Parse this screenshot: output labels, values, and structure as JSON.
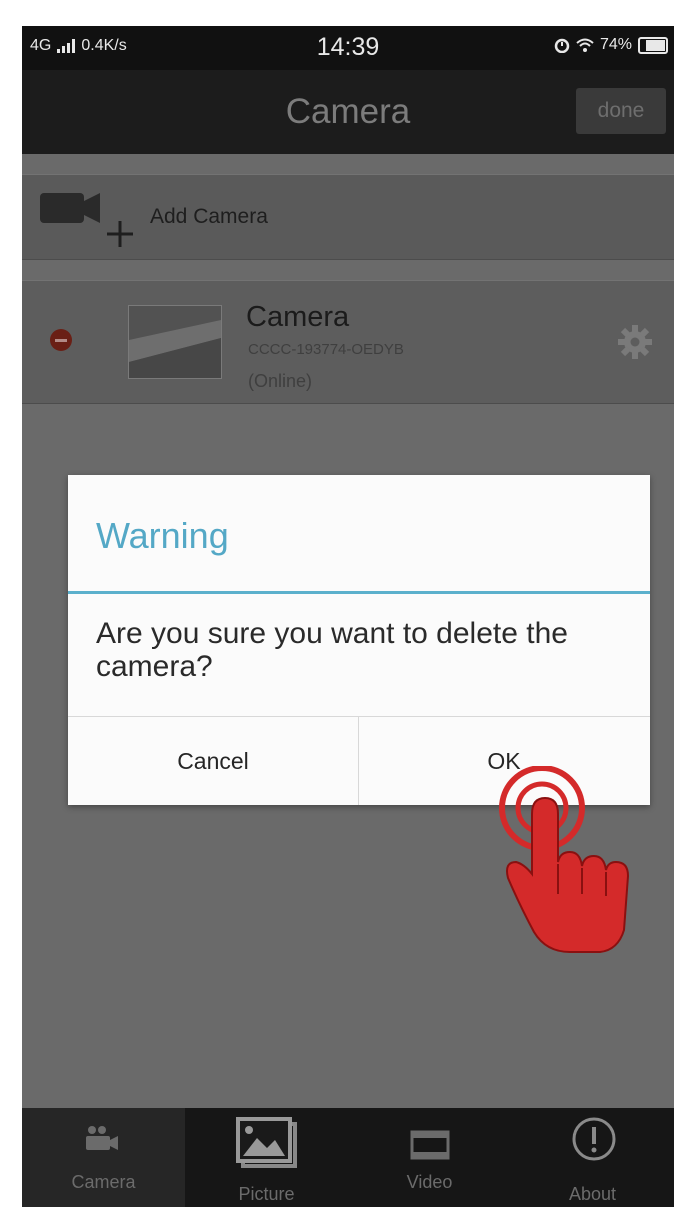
{
  "status_bar": {
    "network": "4G",
    "speed": "0.4K/s",
    "time": "14:39",
    "battery": "74%"
  },
  "header": {
    "title": "Camera",
    "done_label": "done"
  },
  "add_camera": {
    "label": "Add Camera"
  },
  "camera_item": {
    "name": "Camera",
    "id": "CCCC-193774-OEDYB",
    "status": "(Online)"
  },
  "dialog": {
    "title": "Warning",
    "message": "Are you sure you want to delete the camera?",
    "cancel_label": "Cancel",
    "ok_label": "OK"
  },
  "tabs": [
    {
      "label": "Camera",
      "icon": "camera-tab-icon",
      "active": true
    },
    {
      "label": "Picture",
      "icon": "picture-icon",
      "active": false
    },
    {
      "label": "Video",
      "icon": "video-icon",
      "active": false
    },
    {
      "label": "About",
      "icon": "info-icon",
      "active": false
    }
  ],
  "colors": {
    "accent": "#54a8c6",
    "pointer": "#d42a2a",
    "delete": "#6a1f15"
  }
}
